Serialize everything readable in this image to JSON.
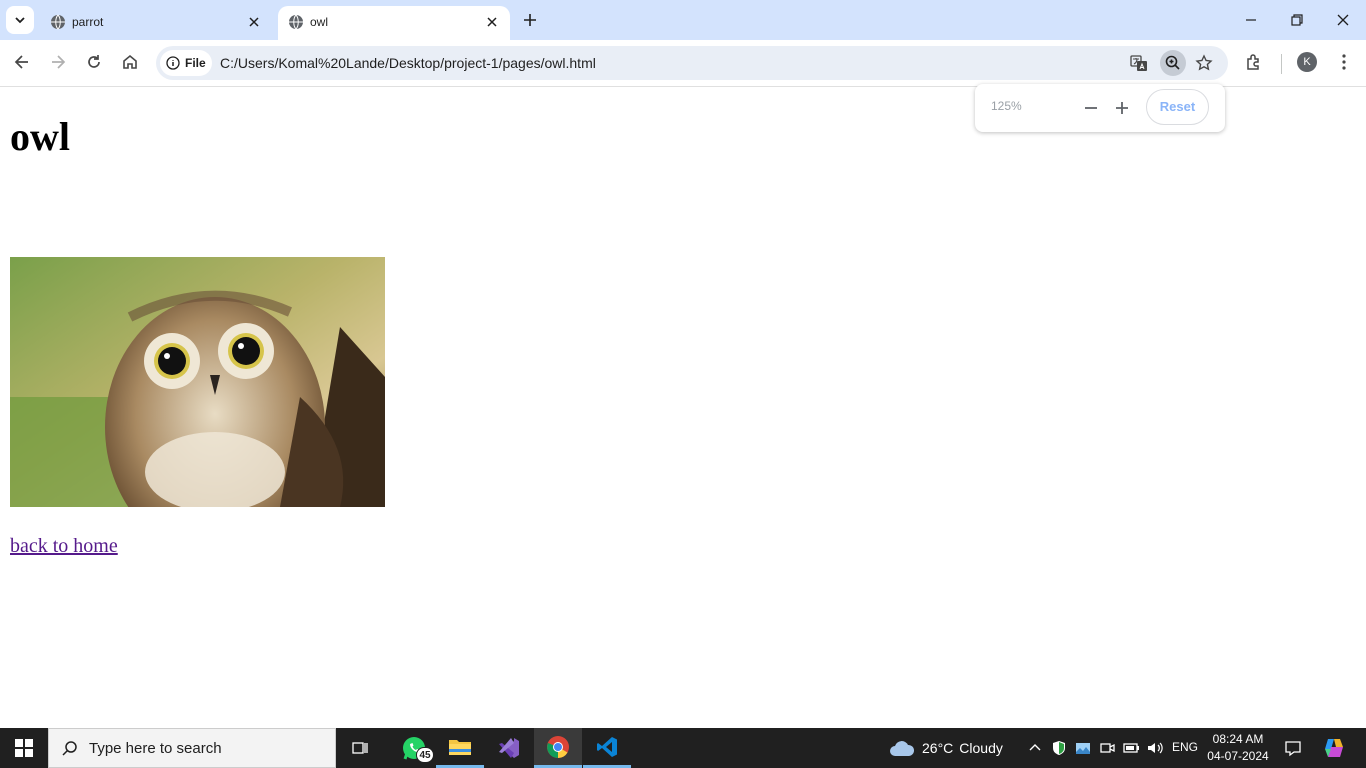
{
  "browser": {
    "tabs": [
      {
        "title": "parrot",
        "active": false
      },
      {
        "title": "owl",
        "active": true
      }
    ],
    "omnibox": {
      "chip_label": "File",
      "url": "C:/Users/Komal%20Lande/Desktop/project-1/pages/owl.html"
    },
    "profile_initial": "K",
    "zoom_popup": {
      "level": "125%",
      "reset_label": "Reset"
    }
  },
  "page": {
    "heading": "owl",
    "image_alt": "owl photo",
    "link_text": "back to home"
  },
  "taskbar": {
    "search_placeholder": "Type here to search",
    "whatsapp_badge": "45",
    "weather": {
      "temp": "26°C",
      "condition": "Cloudy"
    },
    "language": "ENG",
    "time": "08:24 AM",
    "date": "04-07-2024"
  },
  "colors": {
    "tabstrip": "#d3e3fd",
    "omnibox": "#e9eef6",
    "link_visited": "#551a8b",
    "taskbar": "#202020"
  }
}
